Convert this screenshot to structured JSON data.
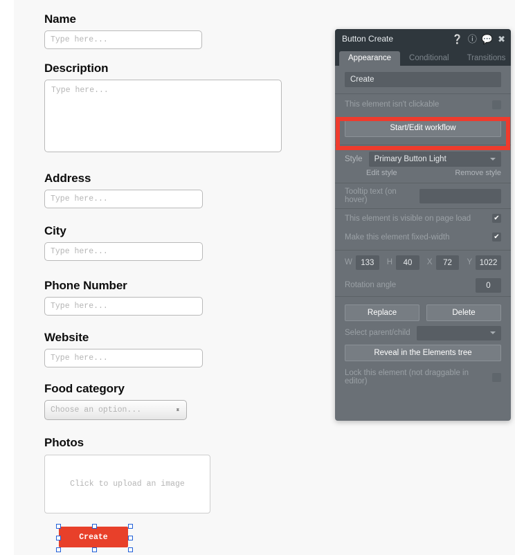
{
  "form": {
    "placeholder": "Type here...",
    "fields": [
      {
        "label": "Name",
        "type": "input",
        "value": ""
      },
      {
        "label": "Description",
        "type": "textarea",
        "value": ""
      },
      {
        "label": "Address",
        "type": "input",
        "value": ""
      },
      {
        "label": "City",
        "type": "input",
        "value": ""
      },
      {
        "label": "Phone Number",
        "type": "input",
        "value": ""
      },
      {
        "label": "Website",
        "type": "input",
        "value": ""
      },
      {
        "label": "Food category",
        "type": "select",
        "value": "Choose an option..."
      },
      {
        "label": "Photos",
        "type": "upload",
        "value": "Click to upload an image"
      }
    ],
    "submit_label": "Create",
    "submit_color": "#e8402a"
  },
  "panel": {
    "title": "Button Create",
    "header_icons": [
      "help-icon",
      "info-icon",
      "comment-icon",
      "close-icon"
    ],
    "tabs": [
      {
        "label": "Appearance",
        "active": true
      },
      {
        "label": "Conditional",
        "active": false
      },
      {
        "label": "Transitions",
        "active": false
      }
    ],
    "text_value": "Create",
    "not_clickable_label": "This element isn't clickable",
    "not_clickable_checked": false,
    "workflow_button": "Start/Edit workflow",
    "highlight_color": "#ef3b2d",
    "style_label": "Style",
    "style_value": "Primary Button Light",
    "edit_style_link": "Edit style",
    "remove_style_link": "Remove style",
    "tooltip_label": "Tooltip text (on hover)",
    "tooltip_value": "",
    "visible_label": "This element is visible on page load",
    "visible_checked": true,
    "fixed_width_label": "Make this element fixed-width",
    "fixed_width_checked": true,
    "geometry": [
      {
        "label": "W",
        "value": "133"
      },
      {
        "label": "H",
        "value": "40"
      },
      {
        "label": "X",
        "value": "72"
      },
      {
        "label": "Y",
        "value": "1022"
      }
    ],
    "rotation_label": "Rotation angle",
    "rotation_value": "0",
    "replace_label": "Replace",
    "delete_label": "Delete",
    "parent_child_label": "Select parent/child",
    "parent_child_value": "",
    "reveal_label": "Reveal in the Elements tree",
    "lock_label": "Lock this element (not draggable in editor)",
    "lock_checked": false
  }
}
